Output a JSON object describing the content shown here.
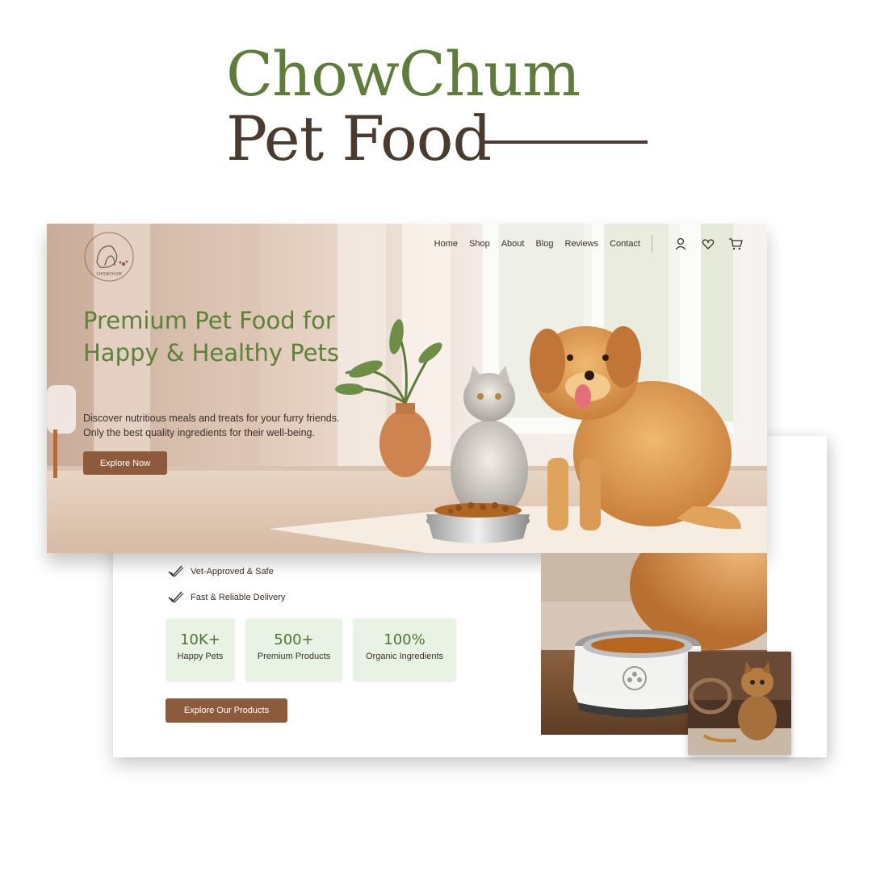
{
  "brand": {
    "line1": "ChowChum",
    "line2": "Pet Food"
  },
  "nav": {
    "items": [
      "Home",
      "Shop",
      "About",
      "Blog",
      "Reviews",
      "Contact"
    ],
    "icons": [
      "user-icon",
      "heart-icon",
      "cart-icon"
    ]
  },
  "logo": {
    "text": "CHOWCHUM"
  },
  "hero": {
    "title": "Premium Pet Food for Happy & Healthy Pets",
    "description": "Discover nutritious meals and treats for your furry friends. Only the best quality ingredients for their well-being.",
    "cta": "Explore Now"
  },
  "features": [
    {
      "label": "Vet-Approved & Safe",
      "icon": "check-icon"
    },
    {
      "label": "Fast & Reliable Delivery",
      "icon": "check-icon"
    }
  ],
  "stats": [
    {
      "value": "10K+",
      "label": "Happy Pets"
    },
    {
      "value": "500+",
      "label": "Premium Products"
    },
    {
      "value": "100%",
      "label": "Organic Ingredients"
    }
  ],
  "products_cta": "Explore Our Products",
  "colors": {
    "brand_green": "#5e7d3a",
    "brand_brown": "#4a3b2e",
    "button_brown": "#8d5a3c",
    "stat_bg": "#e8f3e6"
  }
}
